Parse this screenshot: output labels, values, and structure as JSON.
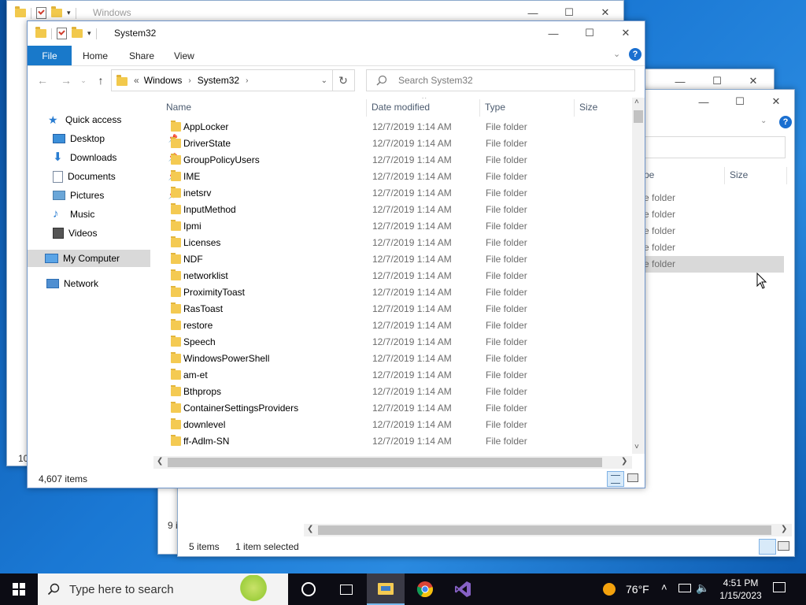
{
  "back_window_1": {
    "title": "Windows",
    "status": "10"
  },
  "back_window_2": {
    "status": "9 i"
  },
  "back_window_3": {
    "columns": {
      "type": "pe",
      "size": "Size"
    },
    "rows": [
      "e folder",
      "e folder",
      "e folder",
      "e folder",
      "e folder"
    ],
    "status_items": "5 items",
    "status_selected": "1 item selected"
  },
  "main_window": {
    "title": "System32",
    "ribbon": {
      "file": "File",
      "home": "Home",
      "share": "Share",
      "view": "View"
    },
    "address": {
      "overflow": "«",
      "crumb1": "Windows",
      "crumb2": "System32"
    },
    "search_placeholder": "Search System32",
    "nav": {
      "quick_access": "Quick access",
      "desktop": "Desktop",
      "downloads": "Downloads",
      "documents": "Documents",
      "pictures": "Pictures",
      "music": "Music",
      "videos": "Videos",
      "my_computer": "My Computer",
      "network": "Network"
    },
    "columns": {
      "name": "Name",
      "date": "Date modified",
      "type": "Type",
      "size": "Size"
    },
    "files": [
      {
        "name": "AppLocker",
        "date": "12/7/2019 1:14 AM",
        "type": "File folder"
      },
      {
        "name": "DriverState",
        "date": "12/7/2019 1:14 AM",
        "type": "File folder"
      },
      {
        "name": "GroupPolicyUsers",
        "date": "12/7/2019 1:14 AM",
        "type": "File folder"
      },
      {
        "name": "IME",
        "date": "12/7/2019 1:14 AM",
        "type": "File folder"
      },
      {
        "name": "inetsrv",
        "date": "12/7/2019 1:14 AM",
        "type": "File folder"
      },
      {
        "name": "InputMethod",
        "date": "12/7/2019 1:14 AM",
        "type": "File folder"
      },
      {
        "name": "Ipmi",
        "date": "12/7/2019 1:14 AM",
        "type": "File folder"
      },
      {
        "name": "Licenses",
        "date": "12/7/2019 1:14 AM",
        "type": "File folder"
      },
      {
        "name": "NDF",
        "date": "12/7/2019 1:14 AM",
        "type": "File folder"
      },
      {
        "name": "networklist",
        "date": "12/7/2019 1:14 AM",
        "type": "File folder"
      },
      {
        "name": "ProximityToast",
        "date": "12/7/2019 1:14 AM",
        "type": "File folder"
      },
      {
        "name": "RasToast",
        "date": "12/7/2019 1:14 AM",
        "type": "File folder"
      },
      {
        "name": "restore",
        "date": "12/7/2019 1:14 AM",
        "type": "File folder"
      },
      {
        "name": "Speech",
        "date": "12/7/2019 1:14 AM",
        "type": "File folder"
      },
      {
        "name": "WindowsPowerShell",
        "date": "12/7/2019 1:14 AM",
        "type": "File folder"
      },
      {
        "name": "am-et",
        "date": "12/7/2019 1:14 AM",
        "type": "File folder"
      },
      {
        "name": "Bthprops",
        "date": "12/7/2019 1:14 AM",
        "type": "File folder"
      },
      {
        "name": "ContainerSettingsProviders",
        "date": "12/7/2019 1:14 AM",
        "type": "File folder"
      },
      {
        "name": "downlevel",
        "date": "12/7/2019 1:14 AM",
        "type": "File folder"
      },
      {
        "name": "ff-Adlm-SN",
        "date": "12/7/2019 1:14 AM",
        "type": "File folder"
      }
    ],
    "status": "4,607 items"
  },
  "taskbar": {
    "search_placeholder": "Type here to search",
    "weather": "76°F",
    "time": "4:51 PM",
    "date": "1/15/2023"
  },
  "colors": {
    "accent": "#1979ca",
    "folder": "#f4ca52",
    "taskbar": "#0c0c14",
    "desktop": "#1a78d4"
  },
  "icons": {
    "start": "windows-logo-icon",
    "search": "search-icon",
    "task_view": "task-view-icon",
    "cortana": "cortana-circle-icon",
    "explorer": "file-explorer-icon",
    "chrome": "chrome-icon",
    "visual_studio": "visual-studio-icon",
    "weather": "sun-icon",
    "notifications": "notification-icon"
  }
}
